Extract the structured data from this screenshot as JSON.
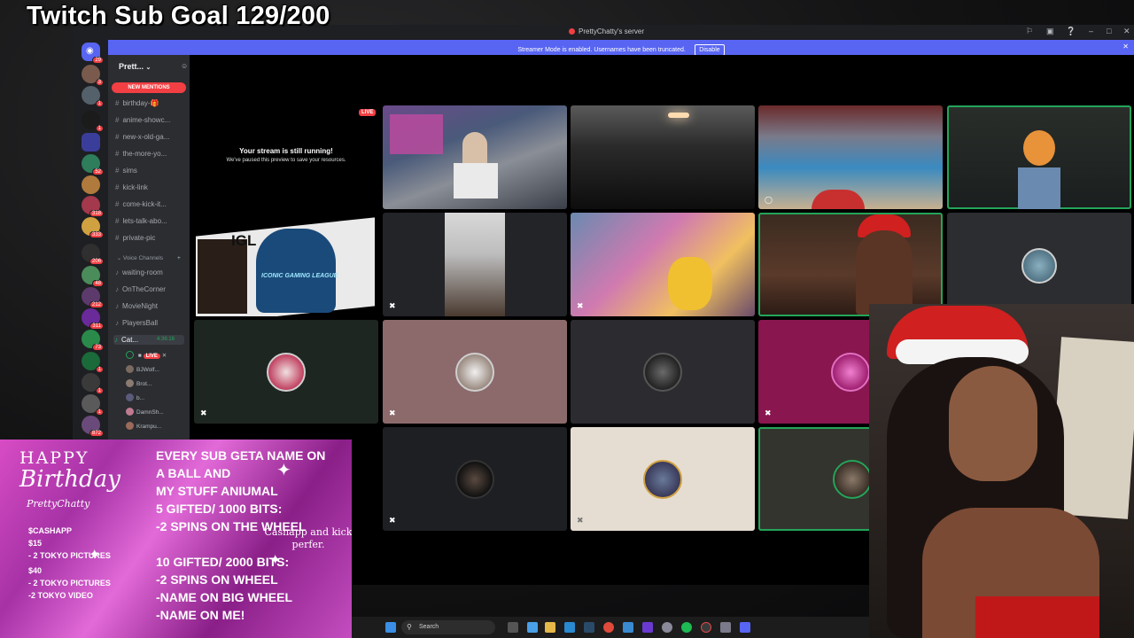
{
  "overlay": {
    "goal_title": "Twitch Sub Goal 129/200"
  },
  "window": {
    "title": "PrettyChatty's server",
    "banner_text": "Streamer Mode is enabled. Usernames have been truncated.",
    "banner_button": "Disable",
    "icons": [
      "pin-icon",
      "screen-icon",
      "help-icon",
      "minimize-icon",
      "maximize-icon",
      "close-icon"
    ]
  },
  "rail": {
    "badges": [
      "29",
      "3",
      "1",
      "1",
      "52",
      "1",
      "318",
      "333",
      "206",
      "48",
      "212",
      "311",
      "73",
      "1",
      "1",
      "1",
      "872"
    ]
  },
  "channels": {
    "server_name": "Prett...",
    "new_mentions": "NEW MENTIONS",
    "text": [
      "birthday-🎁",
      "anime-showc...",
      "new-x-old-ga...",
      "the-more-yo...",
      "sims",
      "kick-link",
      "come-kick-it...",
      "lets-talk-abo...",
      "private-pic"
    ],
    "voice_category": "Voice Channels",
    "voice": [
      "waiting-room",
      "OnTheCorner",
      "MovieNight",
      "PlayersBall"
    ],
    "active_voice": {
      "name": "Cat...",
      "time": "4:36:16"
    },
    "users": [
      "BJWolf...",
      "Brot...",
      "b...",
      "DamnSh...",
      "Krampu..."
    ],
    "live_label": "LIVE"
  },
  "stage": {
    "paused_title": "Your stream is still running!",
    "paused_sub": "We've paused this preview to save your resources.",
    "live_badge": "LIVE",
    "igl_text": "IGL",
    "igl_sub": "ICONIC GAMING LEAGUE"
  },
  "birthday_panel": {
    "happy": "HAPPY",
    "birthday": "Birthday",
    "name": "PrettyChatty",
    "cashapp_lines": [
      "$CASHAPP",
      "$15",
      "- 2 TOKYO PICTURES"
    ],
    "forty_lines": [
      "$40",
      "- 2 TOKYO PICTURES",
      "-2 TOKYO VIDEO"
    ],
    "headline_lines": [
      "EVERY SUB GETA NAME ON A BALL AND",
      "MY STUFF ANIUMAL"
    ],
    "gift5_lines": [
      "5 GIFTED/ 1000 BITS:",
      "-2 SPINS ON THE WHEEL"
    ],
    "gift10_lines": [
      "10 GIFTED/ 2000 BITS:",
      "-2 SPINS ON WHEEL",
      "-NAME ON BIG WHEEL",
      "-NAME ON ME!"
    ],
    "cashapp_kick": [
      "Cashapp and kick",
      "perfer."
    ]
  },
  "taskbar": {
    "search_placeholder": "Search"
  }
}
